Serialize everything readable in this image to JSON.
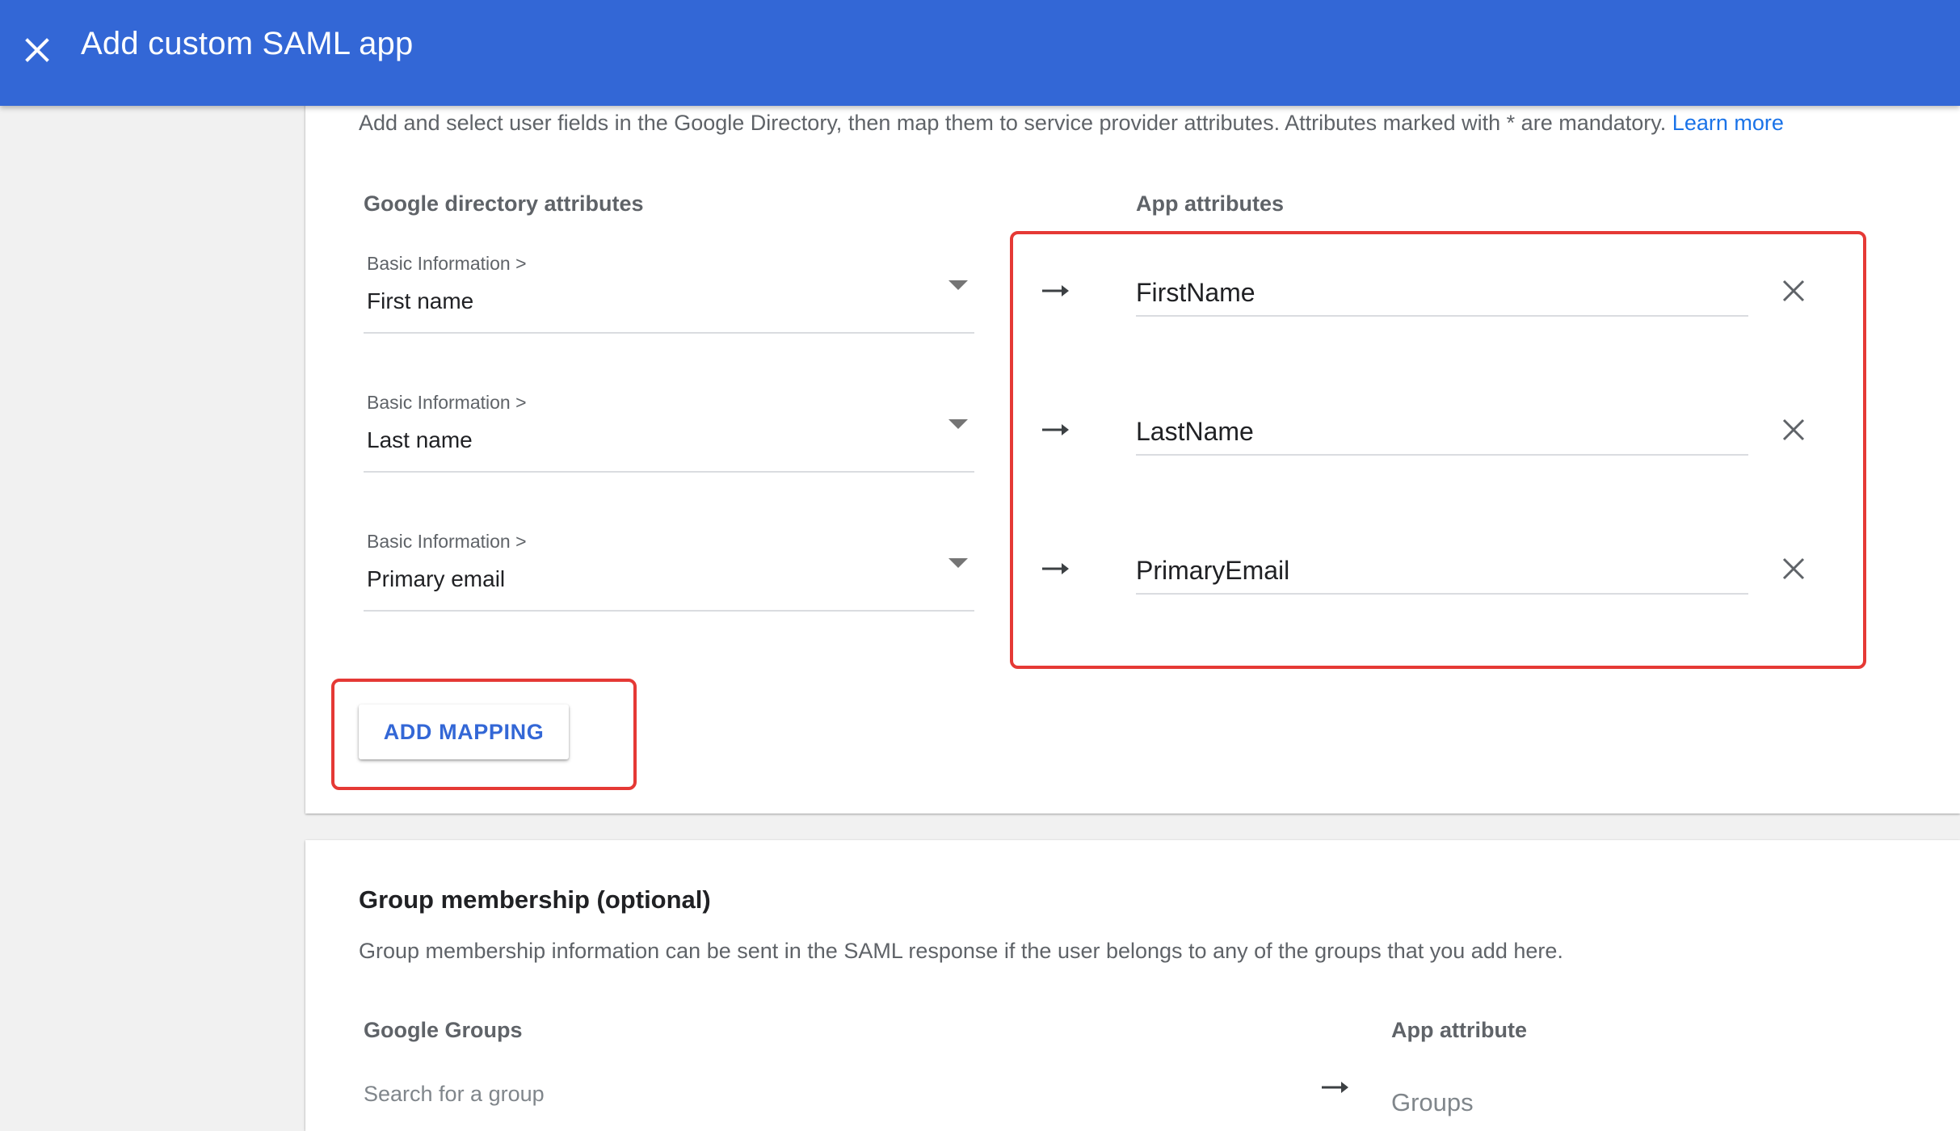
{
  "header": {
    "title": "Add custom SAML app",
    "close_icon": "close-icon",
    "background": "#3367d6"
  },
  "attribute_mapping": {
    "intro_text": "Add and select user fields in the Google Directory, then map them to service provider attributes. Attributes marked with * are mandatory.",
    "learn_more": "Learn more",
    "directory_header": "Google directory attributes",
    "app_header": "App attributes",
    "rows": [
      {
        "category": "Basic Information >",
        "field": "First name",
        "app_attribute": "FirstName"
      },
      {
        "category": "Basic Information >",
        "field": "Last name",
        "app_attribute": "LastName"
      },
      {
        "category": "Basic Information >",
        "field": "Primary email",
        "app_attribute": "PrimaryEmail"
      }
    ],
    "add_mapping_label": "ADD MAPPING"
  },
  "group_membership": {
    "title": "Group membership (optional)",
    "description": "Group membership information can be sent in the SAML response if the user belongs to any of the groups that you add here.",
    "groups_header": "Google Groups",
    "app_attribute_header": "App attribute",
    "search_placeholder": "Search for a group",
    "app_attribute_placeholder": "Groups"
  },
  "colors": {
    "accent": "#3367d6",
    "link": "#1a73e8",
    "highlight": "#e53935"
  }
}
